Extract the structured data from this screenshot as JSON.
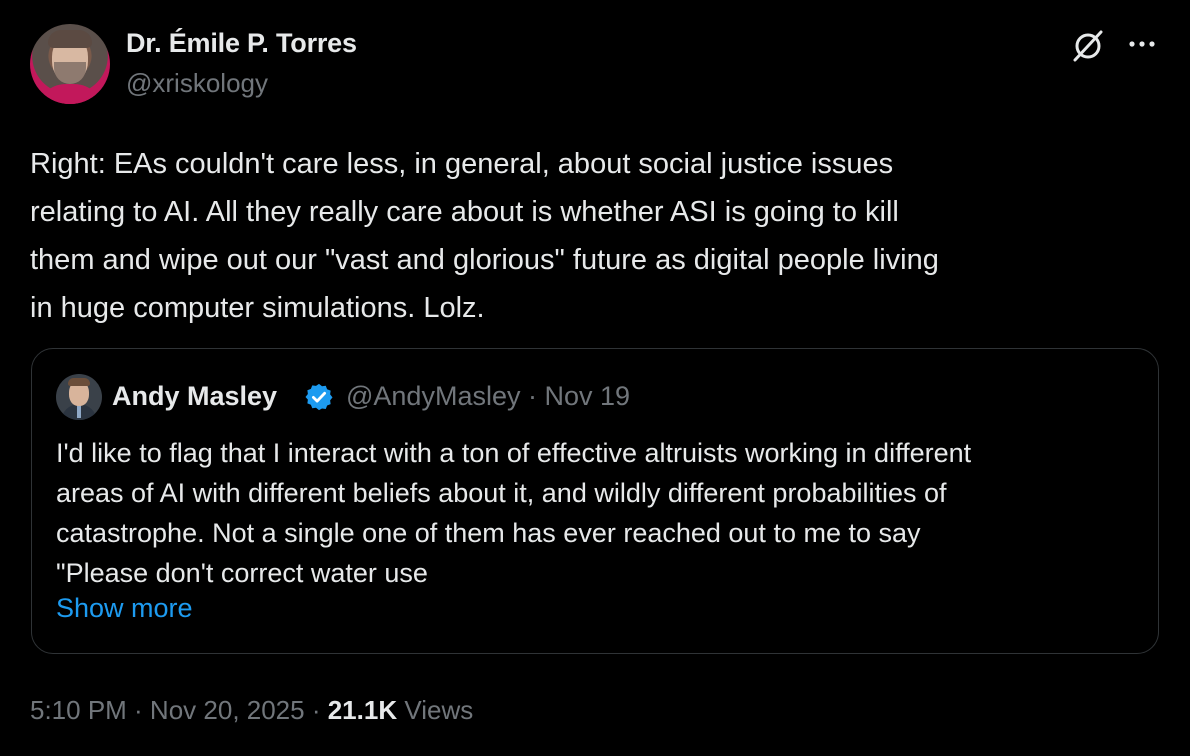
{
  "author": {
    "display_name": "Dr. Émile P. Torres",
    "handle": "@xriskology"
  },
  "tweet": {
    "text": "Right: EAs couldn't care less, in general, about social justice issues\nrelating to AI. All they really care about is whether ASI is going to kill\nthem and wipe out our \"vast and glorious\" future as digital people living\nin huge computer simulations. Lolz."
  },
  "quote": {
    "display_name": "Andy Masley",
    "handle_date": "@AndyMasley · Nov 19",
    "text": "I'd like to flag that I interact with a ton of effective altruists working in different\nareas of AI with different beliefs about it, and wildly different probabilities of\ncatastrophe. Not a single one of them has ever reached out to me to say\n\"Please don't correct water use",
    "show_more": "Show more",
    "verified_color": "#1d9bf0"
  },
  "meta": {
    "timestamp": "5:10 PM · Nov 20, 2025 · ",
    "views_count": "21.1K",
    "views_label": "Views"
  },
  "icons": {
    "top_right": [
      "grok-icon",
      "more-icon"
    ]
  },
  "colors": {
    "background": "#000000",
    "text": "#e7e9ea",
    "secondary": "#71767b",
    "link": "#1d9bf0",
    "border": "#2f3336"
  }
}
